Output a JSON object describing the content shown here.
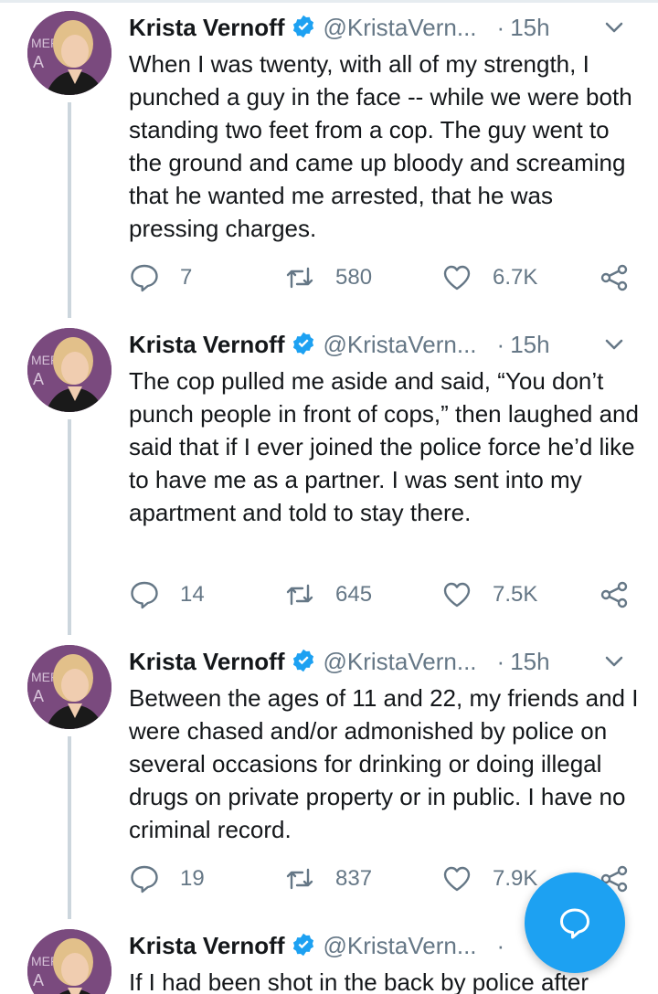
{
  "author": {
    "name": "Krista Vernoff",
    "handle": "@KristaVern...",
    "time": "15h",
    "dot": "·"
  },
  "tweets": [
    {
      "text": "When I was twenty, with all of my strength, I punched a guy in the face -- while we were both standing two feet from a cop. The guy went to the ground and came up bloody and screaming that he wanted me arrested, that he was pressing charges.",
      "replies": "7",
      "retweets": "580",
      "likes": "6.7K"
    },
    {
      "text": "The cop pulled me aside and said, “You don’t punch people in front of cops,” then laughed and said that if I ever joined the police force he’d like to have me as a partner. I was sent into my apartment and told to stay there.",
      "replies": "14",
      "retweets": "645",
      "likes": "7.5K"
    },
    {
      "text": "Between the ages of 11 and 22, my friends and I were chased and/or admonished by police on several occasions for drinking or doing illegal drugs on private property or in public. I have no criminal record.",
      "replies": "19",
      "retweets": "837",
      "likes": "7.9K"
    },
    {
      "text": "If I had been shot in the back by police after"
    }
  ],
  "icons": {
    "reply": "reply-icon",
    "retweet": "retweet-icon",
    "like": "heart-icon",
    "share": "share-icon",
    "verified": "verified-badge-icon",
    "caret": "chevron-down-icon",
    "compose": "compose-reply-icon"
  },
  "colors": {
    "accent": "#1da1f2",
    "secondary_text": "#657786",
    "thread_line": "#ccd6dd"
  }
}
